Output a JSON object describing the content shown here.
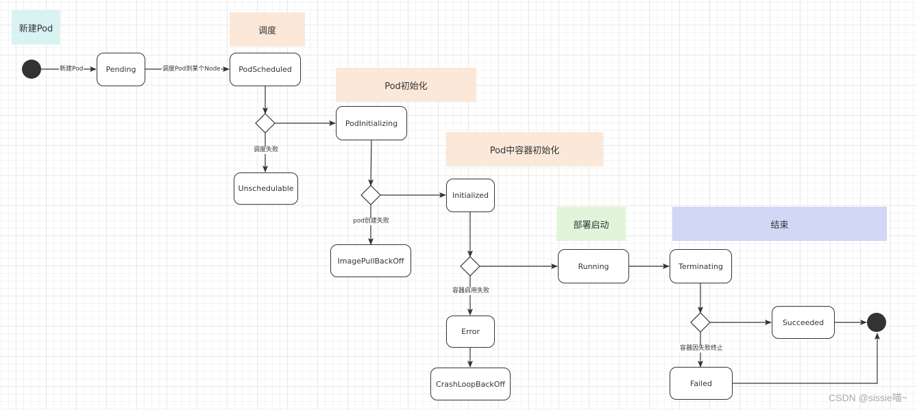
{
  "phases": {
    "create": {
      "label": "新建Pod",
      "color": "#d9f3f3"
    },
    "schedule": {
      "label": "调度",
      "color": "#fbe8d9"
    },
    "pod_init": {
      "label": "Pod初始化",
      "color": "#fbe8d9"
    },
    "container_init": {
      "label": "Pod中容器初始化",
      "color": "#fbe8d9"
    },
    "deploy_start": {
      "label": "部署启动",
      "color": "#e2f5da"
    },
    "end": {
      "label": "结束",
      "color": "#d3d7f6"
    }
  },
  "states": {
    "pending": "Pending",
    "pod_scheduled": "PodScheduled",
    "unschedulable": "Unschedulable",
    "pod_initializing": "PodInitializing",
    "initialized": "Initialized",
    "image_pull_back_off": "ImagePullBackOff",
    "running": "Running",
    "error": "Error",
    "crash_loop_back_off": "CrashLoopBackOff",
    "terminating": "Terminating",
    "succeeded": "Succeeded",
    "failed": "Failed"
  },
  "edge_labels": {
    "create_pod": "新建Pod",
    "schedule_to_node": "调度Pod到某个Node",
    "schedule_failed": "调度失败",
    "pod_create_failed": "pod创建失败",
    "container_start_failed": "容器启用失败",
    "container_terminated_failed": "容器因失败终止"
  },
  "watermark": "CSDN @sissie喵~"
}
